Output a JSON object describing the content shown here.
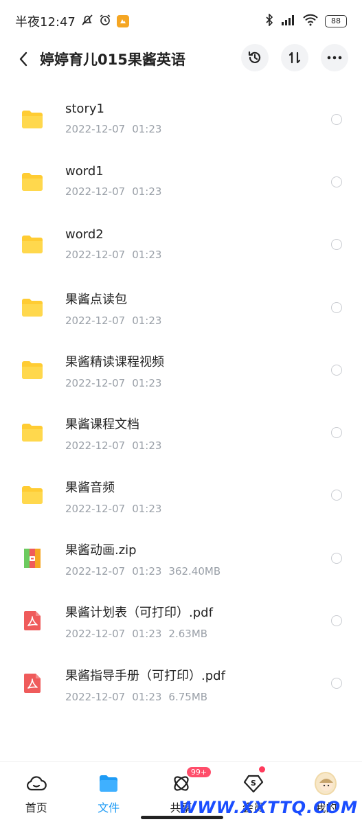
{
  "status_bar": {
    "time": "半夜12:47",
    "battery": "88"
  },
  "header": {
    "title": "婷婷育儿015果酱英语"
  },
  "files": [
    {
      "name": "story1",
      "date": "2022-12-07",
      "time": "01:23",
      "size": "",
      "type": "folder"
    },
    {
      "name": "word1",
      "date": "2022-12-07",
      "time": "01:23",
      "size": "",
      "type": "folder"
    },
    {
      "name": "word2",
      "date": "2022-12-07",
      "time": "01:23",
      "size": "",
      "type": "folder"
    },
    {
      "name": "果酱点读包",
      "date": "2022-12-07",
      "time": "01:23",
      "size": "",
      "type": "folder"
    },
    {
      "name": "果酱精读课程视频",
      "date": "2022-12-07",
      "time": "01:23",
      "size": "",
      "type": "folder"
    },
    {
      "name": "果酱课程文档",
      "date": "2022-12-07",
      "time": "01:23",
      "size": "",
      "type": "folder"
    },
    {
      "name": "果酱音频",
      "date": "2022-12-07",
      "time": "01:23",
      "size": "",
      "type": "folder"
    },
    {
      "name": "果酱动画.zip",
      "date": "2022-12-07",
      "time": "01:23",
      "size": "362.40MB",
      "type": "zip"
    },
    {
      "name": "果酱计划表（可打印）.pdf",
      "date": "2022-12-07",
      "time": "01:23",
      "size": "2.63MB",
      "type": "pdf"
    },
    {
      "name": "果酱指导手册（可打印）.pdf",
      "date": "2022-12-07",
      "time": "01:23",
      "size": "6.75MB",
      "type": "pdf"
    }
  ],
  "bottom_nav": {
    "items": [
      {
        "label": "首页",
        "icon": "home-cloud-icon"
      },
      {
        "label": "文件",
        "icon": "folder-icon",
        "active": true
      },
      {
        "label": "共享",
        "icon": "share-atom-icon",
        "badge": "99+"
      },
      {
        "label": "会员",
        "icon": "vip-diamond-icon"
      },
      {
        "label": "我的",
        "icon": "avatar-icon"
      }
    ]
  },
  "watermark": "WWW.XXTTQ.COM",
  "colors": {
    "accent": "#1e9bf5",
    "folder": "#ffcc33",
    "pdf": "#ef5b5b",
    "badge": "#ff4d6a"
  }
}
